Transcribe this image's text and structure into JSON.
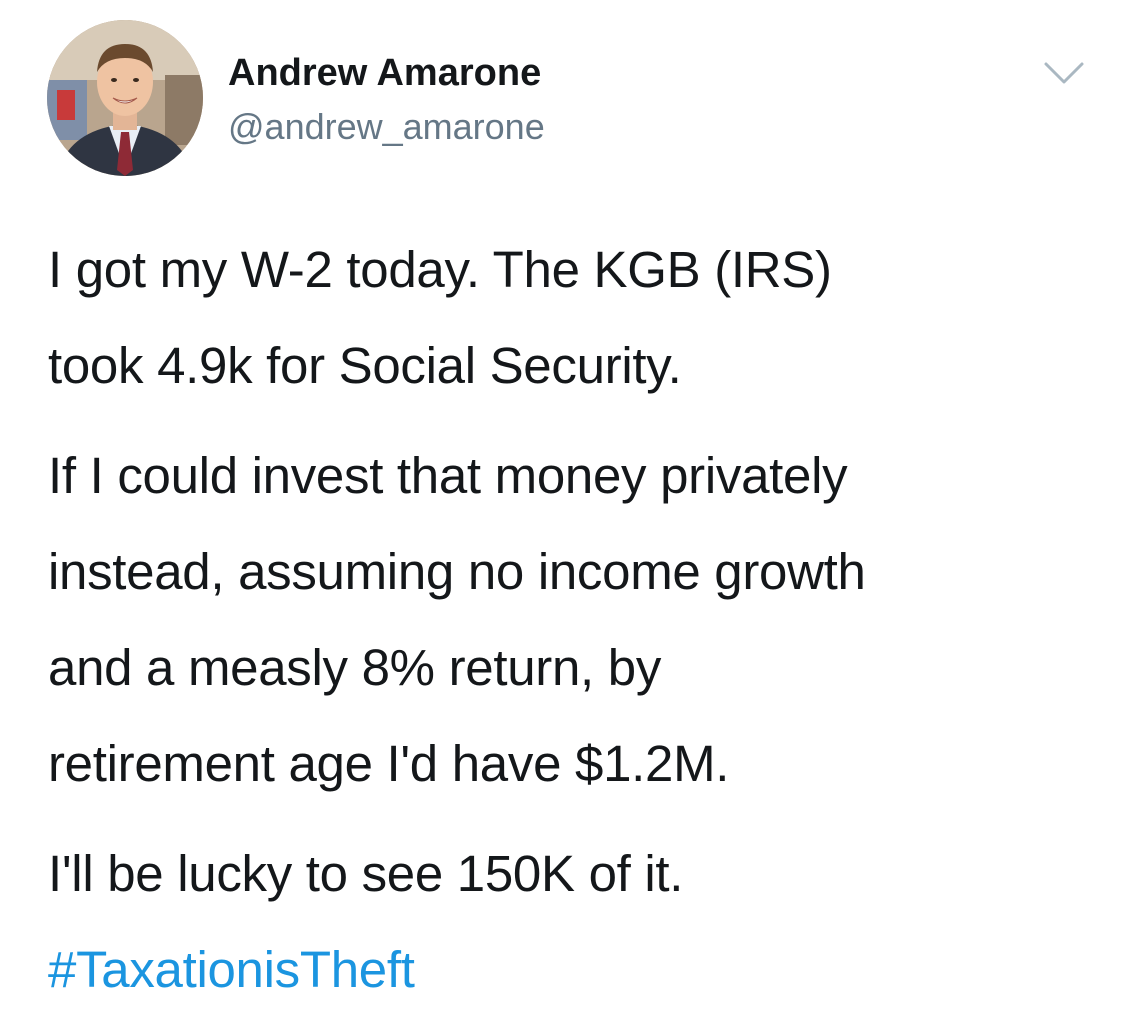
{
  "tweet": {
    "author": {
      "display_name": "Andrew Amarone",
      "handle": "@andrew_amarone",
      "avatar_icon": "profile-photo"
    },
    "menu_icon": "chevron-down-icon",
    "paragraphs": [
      {
        "lines": [
          "I got my W-2 today. The KGB (IRS)",
          "took 4.9k for Social Security."
        ]
      },
      {
        "lines": [
          "If I could invest that money privately",
          "instead, assuming no income growth",
          "and a measly 8% return, by",
          "retirement age I'd have $1.2M."
        ]
      },
      {
        "lines": [
          "I'll be lucky to see 150K of it."
        ]
      }
    ],
    "hashtag": "#TaxationisTheft"
  },
  "colors": {
    "text": "#14171a",
    "secondary": "#657786",
    "link": "#1b95e0",
    "background": "#ffffff"
  }
}
